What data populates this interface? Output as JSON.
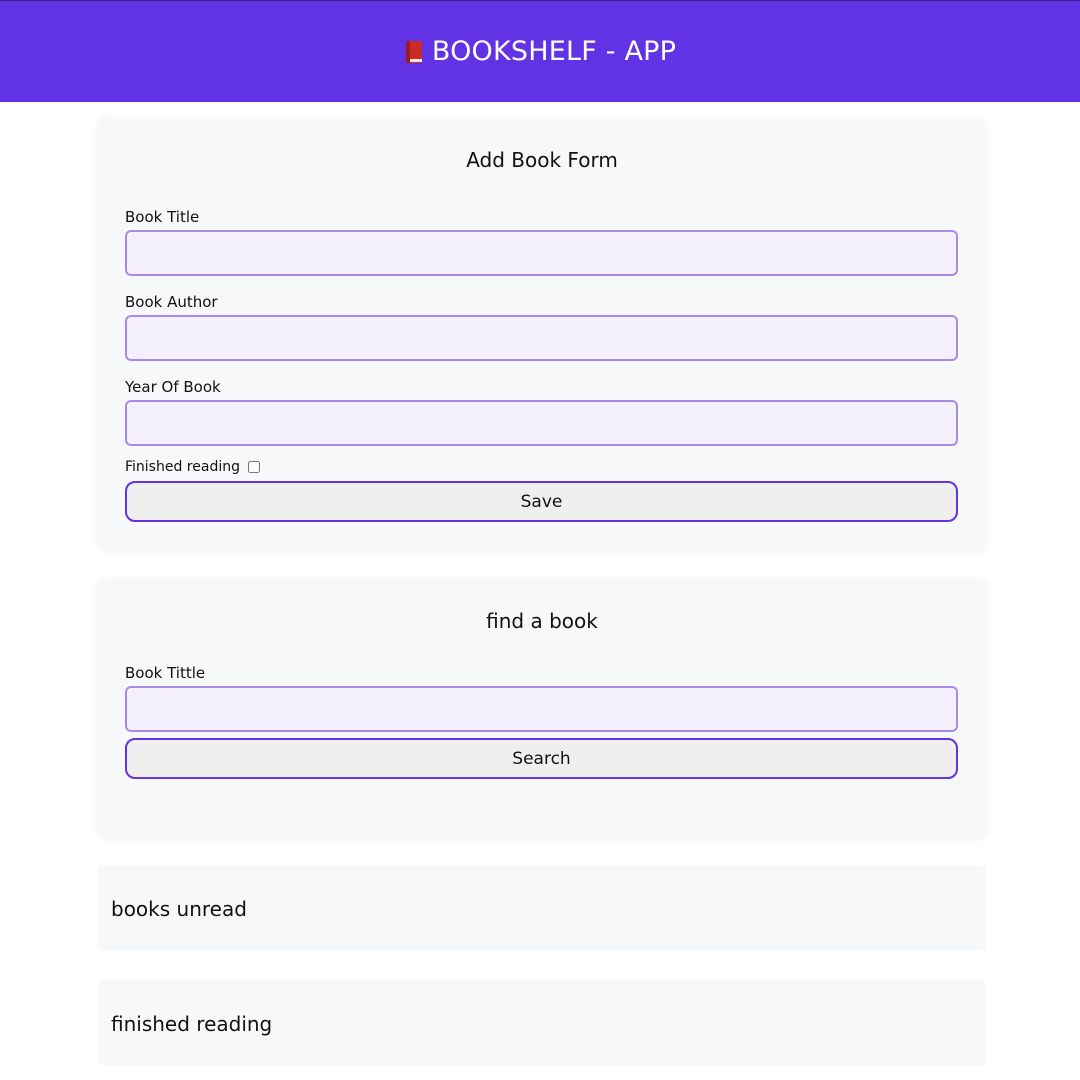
{
  "header": {
    "title": "BOOKSHELF - APP",
    "icon": "book-icon",
    "background": "#6232e5"
  },
  "add_form": {
    "title": "Add Book Form",
    "title_label": "Book Title",
    "title_value": "",
    "author_label": "Book Author",
    "author_value": "",
    "year_label": "Year Of Book",
    "year_value": "",
    "finished_label": "Finished reading",
    "finished_checked": false,
    "save_label": "Save"
  },
  "search_form": {
    "title": "find a book",
    "title_label": "Book Tittle",
    "title_value": "",
    "search_label": "Search"
  },
  "lists": {
    "unread_title": "books unread",
    "finished_title": "finished reading"
  },
  "colors": {
    "accent": "#6232e5",
    "input_border": "#a88ae8",
    "input_background": "#f4f0fd",
    "card_background": "#f7f8fa"
  }
}
